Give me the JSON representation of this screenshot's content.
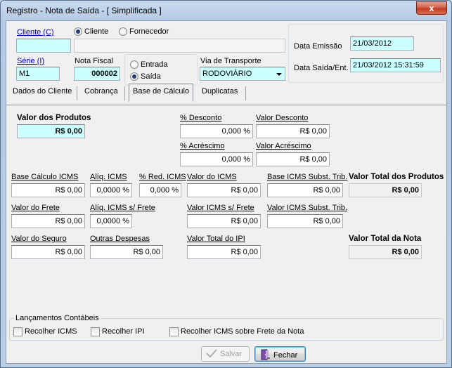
{
  "window": {
    "title": "Registro - Nota de Saída - [ Simplificada ]",
    "close_glyph": "x"
  },
  "header": {
    "cliente_label": "Cliente (C)",
    "cliente_code": "",
    "cliente_name": "",
    "radio_cliente": "Cliente",
    "radio_fornecedor": "Fornecedor",
    "serie_label": "Série (I)",
    "serie_value": "M1",
    "nota_label": "Nota Fiscal",
    "nota_value": "000002",
    "radio_entrada": "Entrada",
    "radio_saida": "Saída",
    "via_label": "Via de Transporte",
    "via_value": "RODOVIÁRIO",
    "data_emissao_label": "Data Emissão",
    "data_emissao_value": "21/03/2012",
    "data_saida_label": "Data Saída/Ent.",
    "data_saida_value": "21/03/2012 15:31:59"
  },
  "tabs": [
    {
      "label": "Dados do Cliente"
    },
    {
      "label": "Cobrança"
    },
    {
      "label": "Base de Cálculo"
    },
    {
      "label": "Duplicatas"
    }
  ],
  "calc": {
    "valor_produtos_label": "Valor dos Produtos",
    "valor_produtos_value": "R$ 0,00",
    "desconto_pct_label": "% Desconto",
    "desconto_pct_value": "0,000 %",
    "valor_desconto_label": "Valor Desconto",
    "valor_desconto_value": "R$ 0,00",
    "acrescimo_pct_label": "% Acréscimo",
    "acrescimo_pct_value": "0,000 %",
    "valor_acrescimo_label": "Valor Acréscimo",
    "valor_acrescimo_value": "R$ 0,00",
    "base_icms_label": "Base Cálculo ICMS",
    "base_icms_value": "R$ 0,00",
    "aliq_icms_label": "Alíq. ICMS",
    "aliq_icms_value": "0,0000 %",
    "red_icms_label": "% Red. ICMS",
    "red_icms_value": "0,000 %",
    "valor_icms_label": "Valor do ICMS",
    "valor_icms_value": "R$ 0,00",
    "base_icms_st_label": "Base ICMS Subst. Trib.",
    "base_icms_st_value": "R$ 0,00",
    "total_produtos_label": "Valor Total dos Produtos",
    "total_produtos_value": "R$ 0,00",
    "valor_frete_label": "Valor do Frete",
    "valor_frete_value": "R$ 0,00",
    "aliq_frete_label": "Alíq. ICMS s/ Frete",
    "aliq_frete_value": "0,0000 %",
    "valor_icms_frete_label": "Valor ICMS s/ Frete",
    "valor_icms_frete_value": "R$ 0,00",
    "valor_icms_st_label": "Valor ICMS Subst. Trib.",
    "valor_icms_st_value": "R$ 0,00",
    "valor_seguro_label": "Valor do Seguro",
    "valor_seguro_value": "R$ 0,00",
    "outras_label": "Outras Despesas",
    "outras_value": "R$ 0,00",
    "total_ipi_label": "Valor Total do IPI",
    "total_ipi_value": "R$ 0,00",
    "total_nota_label": "Valor Total da Nota",
    "total_nota_value": "R$ 0,00"
  },
  "lancamentos": {
    "title": "Lançamentos Contábeis",
    "recolher_icms": "Recolher ICMS",
    "recolher_ipi": "Recolher IPI",
    "recolher_icms_frete": "Recolher ICMS sobre Frete da Nota"
  },
  "footer": {
    "salvar": "Salvar",
    "fechar": "Fechar"
  }
}
